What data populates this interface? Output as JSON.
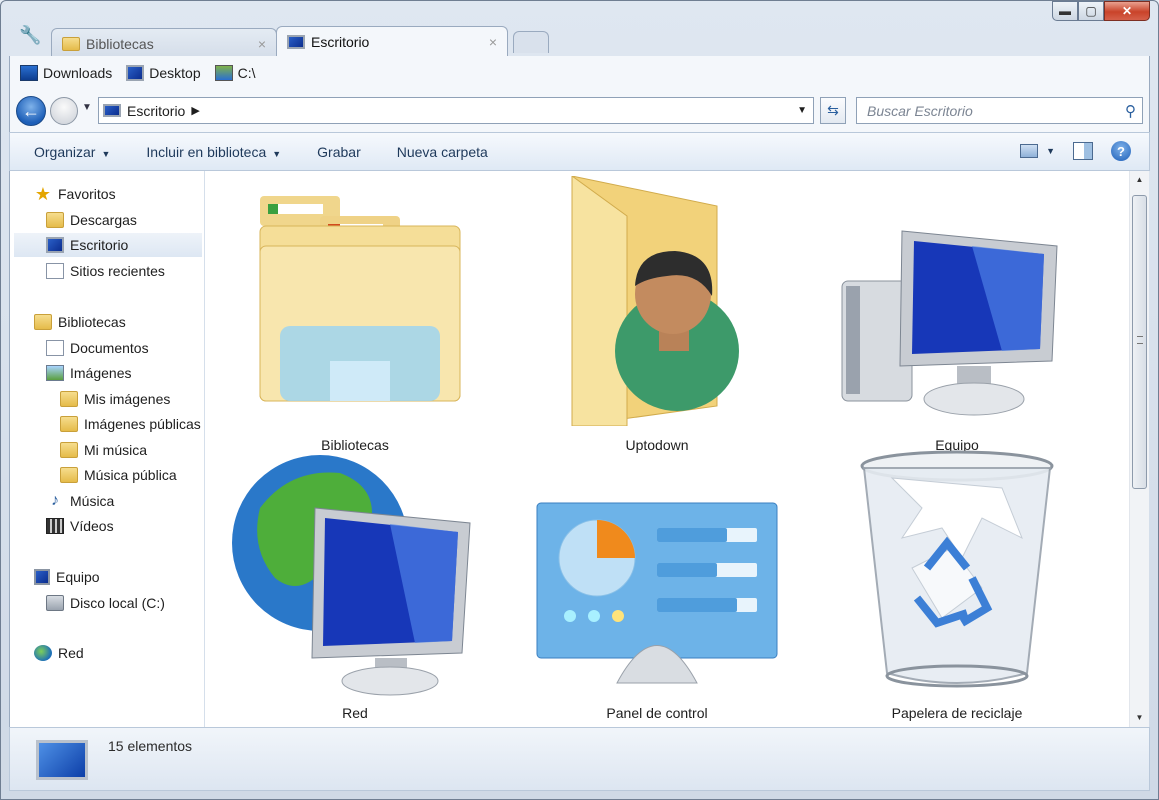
{
  "window": {
    "controls": {
      "minimize": "▬",
      "maximize": "▢",
      "close": "✕"
    }
  },
  "tabs": [
    {
      "label": "Bibliotecas",
      "active": false,
      "close": "×"
    },
    {
      "label": "Escritorio",
      "active": true,
      "close": "×"
    }
  ],
  "bookmarks": [
    {
      "label": "Downloads",
      "icon": "downloads-icon"
    },
    {
      "label": "Desktop",
      "icon": "desktop-icon"
    },
    {
      "label": "C:\\",
      "icon": "drive-icon"
    }
  ],
  "address": {
    "path": "Escritorio",
    "search_placeholder": "Buscar Escritorio"
  },
  "command_bar": {
    "organize": "Organizar",
    "include": "Incluir en biblioteca",
    "burn": "Grabar",
    "new_folder": "Nueva carpeta"
  },
  "navigation": {
    "favorites": "Favoritos",
    "downloads": "Descargas",
    "desktop": "Escritorio",
    "recent": "Sitios recientes",
    "libraries": "Bibliotecas",
    "documents": "Documentos",
    "images": "Imágenes",
    "my_images": "Mis imágenes",
    "public_images": "Imágenes públicas",
    "my_music": "Mi música",
    "public_music": "Música pública",
    "music": "Música",
    "videos": "Vídeos",
    "computer": "Equipo",
    "local_disk": "Disco local (C:)",
    "network": "Red"
  },
  "items": [
    {
      "label": "Bibliotecas",
      "icon": "libraries-icon"
    },
    {
      "label": "Uptodown",
      "icon": "user-folder-icon"
    },
    {
      "label": "Equipo",
      "icon": "computer-icon"
    },
    {
      "label": "Red",
      "icon": "network-icon"
    },
    {
      "label": "Panel de control",
      "icon": "control-panel-icon"
    },
    {
      "label": "Papelera de reciclaje",
      "icon": "recycle-bin-icon"
    }
  ],
  "details": {
    "count": "15 elementos"
  },
  "colors": {
    "chrome": "#dfe7f1",
    "accent": "#1d5fb8",
    "selection": "#dde7f3"
  }
}
